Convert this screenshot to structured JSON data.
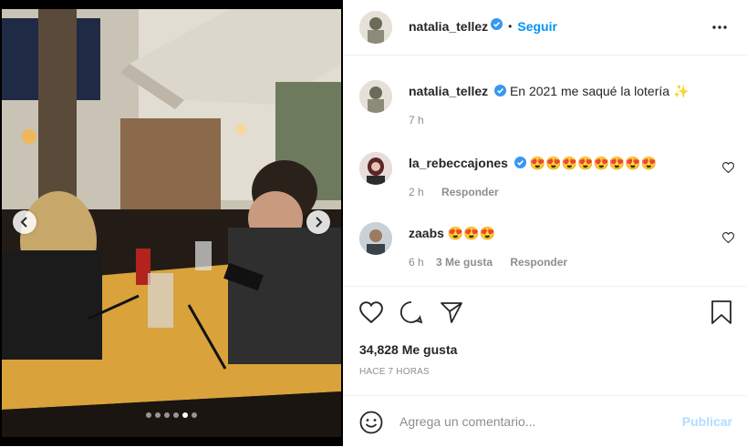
{
  "post": {
    "carousel": {
      "total_slides": 6,
      "active_slide": 5
    }
  },
  "header": {
    "username": "natalia_tellez",
    "separator": "•",
    "follow_label": "Seguir",
    "more_icon": "more-horizontal-icon"
  },
  "caption": {
    "username": "natalia_tellez",
    "text": "En 2021 me saqué la lotería ✨",
    "time": "7 h"
  },
  "comments": [
    {
      "username": "la_rebeccajones",
      "verified": true,
      "text": "😍😍😍😍😍😍😍😍",
      "time": "2 h",
      "likes": "",
      "reply_label": "Responder"
    },
    {
      "username": "zaabs",
      "verified": false,
      "text": "😍😍😍",
      "time": "6 h",
      "likes": "3 Me gusta",
      "reply_label": "Responder"
    }
  ],
  "actions": {
    "like_icon": "heart-icon",
    "comment_icon": "comment-icon",
    "share_icon": "paper-plane-icon",
    "save_icon": "bookmark-icon"
  },
  "likes_text": "34,828 Me gusta",
  "time_ago": "HACE 7 HORAS",
  "add_comment": {
    "placeholder": "Agrega un comentario...",
    "publish_label": "Publicar"
  },
  "colors": {
    "link": "#0095f6",
    "publish_disabled": "#b3dbff",
    "verified": "#3897f0",
    "muted": "#8e8e8e"
  }
}
